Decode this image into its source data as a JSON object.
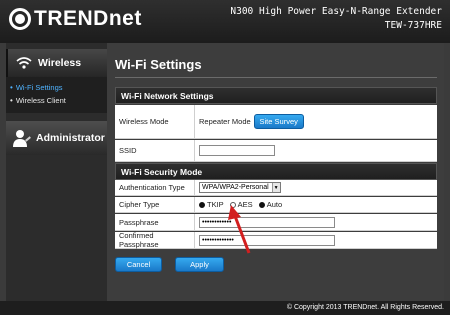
{
  "header": {
    "logo_text": "TRENDnet",
    "product_name": "N300 High Power Easy-N-Range Extender",
    "model": "TEW-737HRE"
  },
  "sidebar": {
    "wireless_label": "Wireless",
    "items": [
      {
        "label": "Wi-Fi Settings",
        "active": true
      },
      {
        "label": "Wireless Client",
        "active": false
      }
    ],
    "admin_label": "Administrator"
  },
  "main": {
    "title": "Wi-Fi Settings",
    "network_section": "Wi-Fi Network Settings",
    "wireless_mode_label": "Wireless Mode",
    "wireless_mode_value": "Repeater Mode",
    "site_survey_label": "Site Survey",
    "ssid_label": "SSID",
    "ssid_value": "",
    "security_section": "Wi-Fi Security Mode",
    "auth_label": "Authentication Type",
    "auth_value": "WPA/WPA2-Personal",
    "cipher_label": "Cipher Type",
    "cipher_options": [
      "TKIP",
      "AES",
      "Auto"
    ],
    "passphrase_label": "Passphrase",
    "passphrase_value": "••••••••••••",
    "confirm_label": "Confirmed Passphrase",
    "confirm_value": "•••••••••••••",
    "cancel_label": "Cancel",
    "apply_label": "Apply"
  },
  "footer": {
    "copyright": "© Copyright 2013 TRENDnet. All Rights Reserved."
  },
  "colors": {
    "accent_blue": "#1a79c8",
    "active_link": "#4fb3ff",
    "annotation_arrow": "#d21f1f"
  }
}
